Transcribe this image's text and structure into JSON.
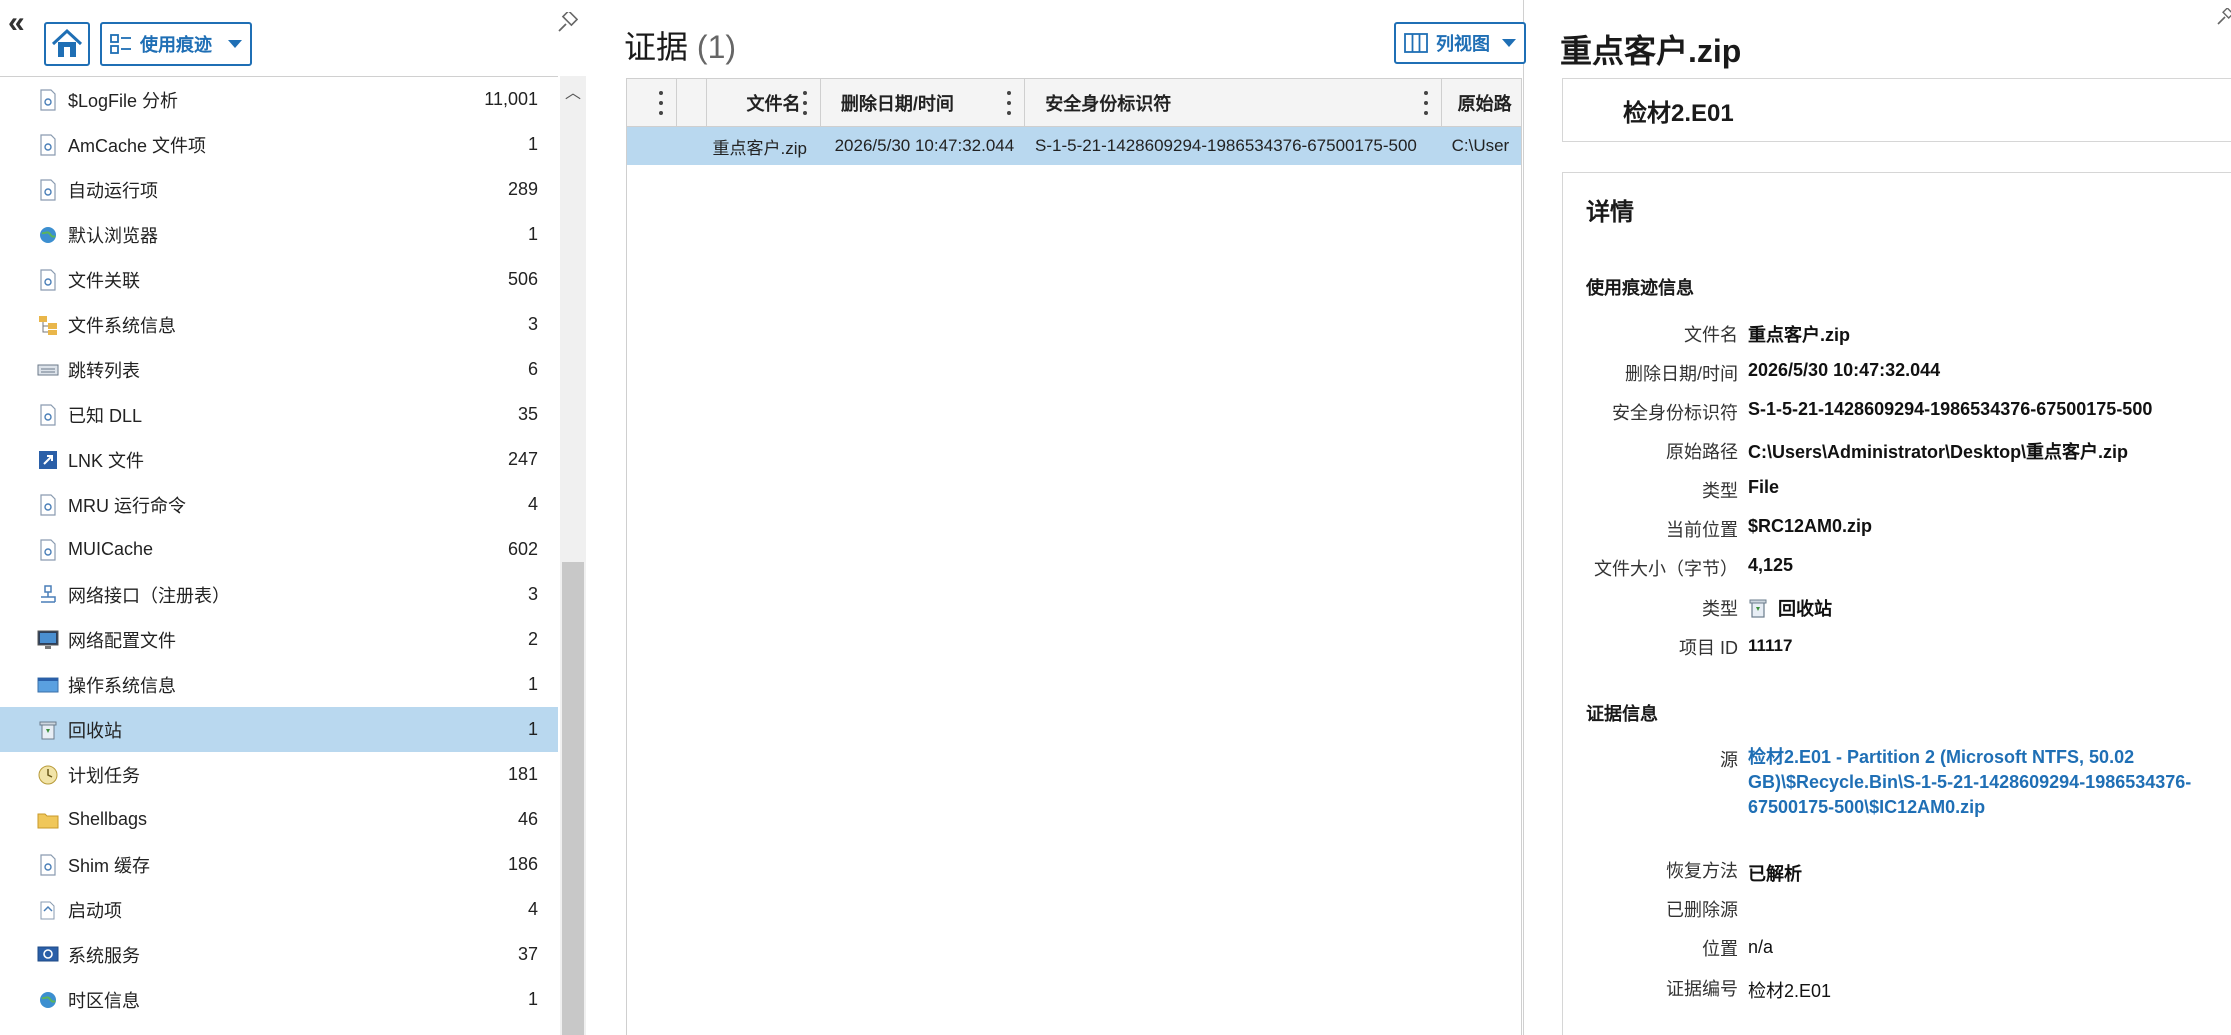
{
  "left_panel": {
    "collapse_glyph": "«",
    "view_selector_label": "使用痕迹",
    "categories": [
      {
        "label": "$LogFile 分析",
        "count": "11,001",
        "icon": "generic-doc-icon"
      },
      {
        "label": "AmCache 文件项",
        "count": "1",
        "icon": "generic-doc-icon"
      },
      {
        "label": "自动运行项",
        "count": "289",
        "icon": "generic-doc-icon"
      },
      {
        "label": "默认浏览器",
        "count": "1",
        "icon": "globe-icon"
      },
      {
        "label": "文件关联",
        "count": "506",
        "icon": "generic-doc-icon"
      },
      {
        "label": "文件系统信息",
        "count": "3",
        "icon": "folder-tree-icon"
      },
      {
        "label": "跳转列表",
        "count": "6",
        "icon": "keyboard-icon"
      },
      {
        "label": "已知 DLL",
        "count": "35",
        "icon": "generic-doc-icon"
      },
      {
        "label": "LNK 文件",
        "count": "247",
        "icon": "shortcut-icon"
      },
      {
        "label": "MRU 运行命令",
        "count": "4",
        "icon": "generic-doc-icon"
      },
      {
        "label": "MUICache",
        "count": "602",
        "icon": "generic-doc-icon"
      },
      {
        "label": "网络接口（注册表）",
        "count": "3",
        "icon": "network-icon"
      },
      {
        "label": "网络配置文件",
        "count": "2",
        "icon": "monitor-icon"
      },
      {
        "label": "操作系统信息",
        "count": "1",
        "icon": "window-icon"
      },
      {
        "label": "回收站",
        "count": "1",
        "icon": "recycle-bin-icon"
      },
      {
        "label": "计划任务",
        "count": "181",
        "icon": "clock-disc-icon"
      },
      {
        "label": "Shellbags",
        "count": "46",
        "icon": "folder-icon"
      },
      {
        "label": "Shim 缓存",
        "count": "186",
        "icon": "generic-doc-icon"
      },
      {
        "label": "启动项",
        "count": "4",
        "icon": "startup-icon"
      },
      {
        "label": "系统服务",
        "count": "37",
        "icon": "service-icon"
      },
      {
        "label": "时区信息",
        "count": "1",
        "icon": "globe-icon"
      }
    ],
    "selected_index": 14
  },
  "middle_panel": {
    "title": "证据",
    "count": "(1)",
    "column_view_label": "列视图",
    "columns": [
      "",
      "",
      "文件名",
      "删除日期/时间",
      "安全身份标识符",
      "原始路"
    ],
    "rows": [
      {
        "cells": [
          "",
          "",
          "重点客户.zip",
          "2026/5/30 10:47:32.044",
          "S-1-5-21-1428609294-1986534376-67500175-500",
          "C:\\User"
        ]
      }
    ]
  },
  "right_panel": {
    "title": "重点客户.zip",
    "evidence_source": "检材2.E01",
    "details_heading": "详情",
    "artifact_section": "使用痕迹信息",
    "artifact_fields": [
      {
        "label": "文件名",
        "value": "重点客户.zip"
      },
      {
        "label": "删除日期/时间",
        "value": "2026/5/30 10:47:32.044"
      },
      {
        "label": "安全身份标识符",
        "value": "S-1-5-21-1428609294-1986534376-67500175-500"
      },
      {
        "label": "原始路径",
        "value": "C:\\Users\\Administrator\\Desktop\\重点客户.zip"
      },
      {
        "label": "类型",
        "value": "File"
      },
      {
        "label": "当前位置",
        "value": "$RC12AM0.zip"
      },
      {
        "label": "文件大小（字节）",
        "value": "4,125"
      },
      {
        "label": "类型",
        "value": "回收站"
      },
      {
        "label": "项目 ID",
        "value": "11117"
      }
    ],
    "evidence_section": "证据信息",
    "evidence_fields": [
      {
        "label": "源",
        "value": "检材2.E01 - Partition 2 (Microsoft NTFS, 50.02 GB)\\$Recycle.Bin\\S-1-5-21-1428609294-1986534376-67500175-500\\$IC12AM0.zip"
      },
      {
        "label": "恢复方法",
        "value": "已解析"
      },
      {
        "label": "已删除源",
        "value": ""
      },
      {
        "label": "位置",
        "value": "n/a"
      },
      {
        "label": "证据编号",
        "value": "检材2.E01"
      }
    ]
  },
  "colors": {
    "accent": "#1f6fb5",
    "selection": "#b9d8ef",
    "border": "#cfcfcf"
  }
}
